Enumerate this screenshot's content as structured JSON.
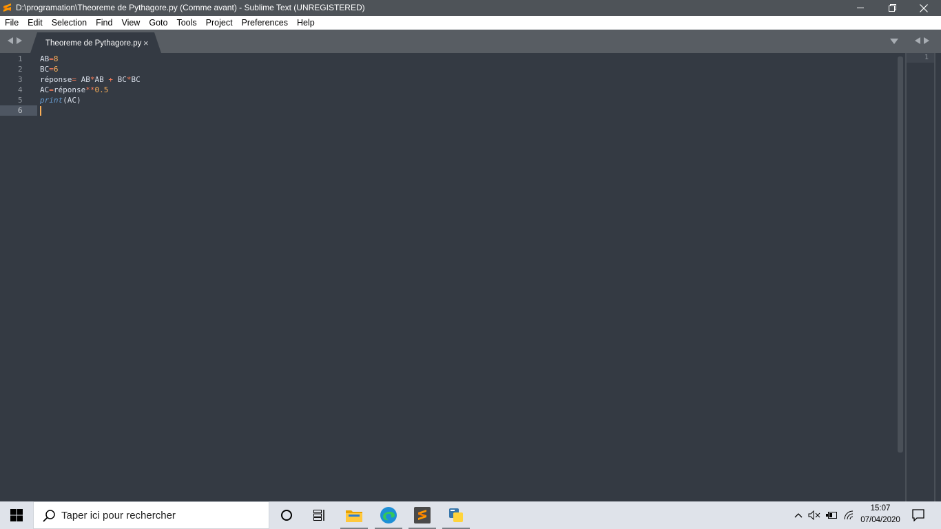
{
  "window": {
    "title": "D:\\programation\\Theoreme de Pythagore.py (Comme avant) - Sublime Text (UNREGISTERED)",
    "controls": [
      "minimize-icon",
      "restore-icon",
      "close-icon"
    ]
  },
  "menu": {
    "items": [
      "File",
      "Edit",
      "Selection",
      "Find",
      "View",
      "Goto",
      "Tools",
      "Project",
      "Preferences",
      "Help"
    ]
  },
  "tabs": [
    {
      "label": "Theoreme de Pythagore.py",
      "close": "×",
      "active": true
    }
  ],
  "editor": {
    "line_numbers": [
      "1",
      "2",
      "3",
      "4",
      "5",
      "6"
    ],
    "active_line": 6,
    "minimap_line": "1",
    "code": {
      "l1": {
        "a": "AB",
        "b": "=",
        "c": "8"
      },
      "l2": {
        "a": "BC",
        "b": "=",
        "c": "6"
      },
      "l3": {
        "a": "réponse",
        "b": "=",
        "c": " AB",
        "d": "*",
        "e": "AB ",
        "f": "+",
        "g": " BC",
        "h": "*",
        "i": "BC"
      },
      "l4": {
        "a": "AC",
        "b": "=",
        "c": "réponse",
        "d": "**",
        "e": "0.5"
      },
      "l5": {
        "a": "print",
        "b": "(AC)"
      }
    },
    "colors": {
      "background": "#343a43",
      "operator": "#f97b58",
      "number": "#f9ae58",
      "function": "#6699cc",
      "text": "#d8dee9"
    }
  },
  "taskbar": {
    "search_placeholder": "Taper ici pour rechercher",
    "time": "15:07",
    "date": "07/04/2020",
    "icons": [
      "windows-start-icon",
      "cortana-icon",
      "task-view-icon",
      "file-explorer-icon",
      "edge-icon",
      "sublime-text-icon",
      "python-icon"
    ],
    "tray_icons": [
      "chevron-up-icon",
      "volume-muted-icon",
      "battery-icon",
      "wifi-icon",
      "notifications-icon"
    ]
  }
}
